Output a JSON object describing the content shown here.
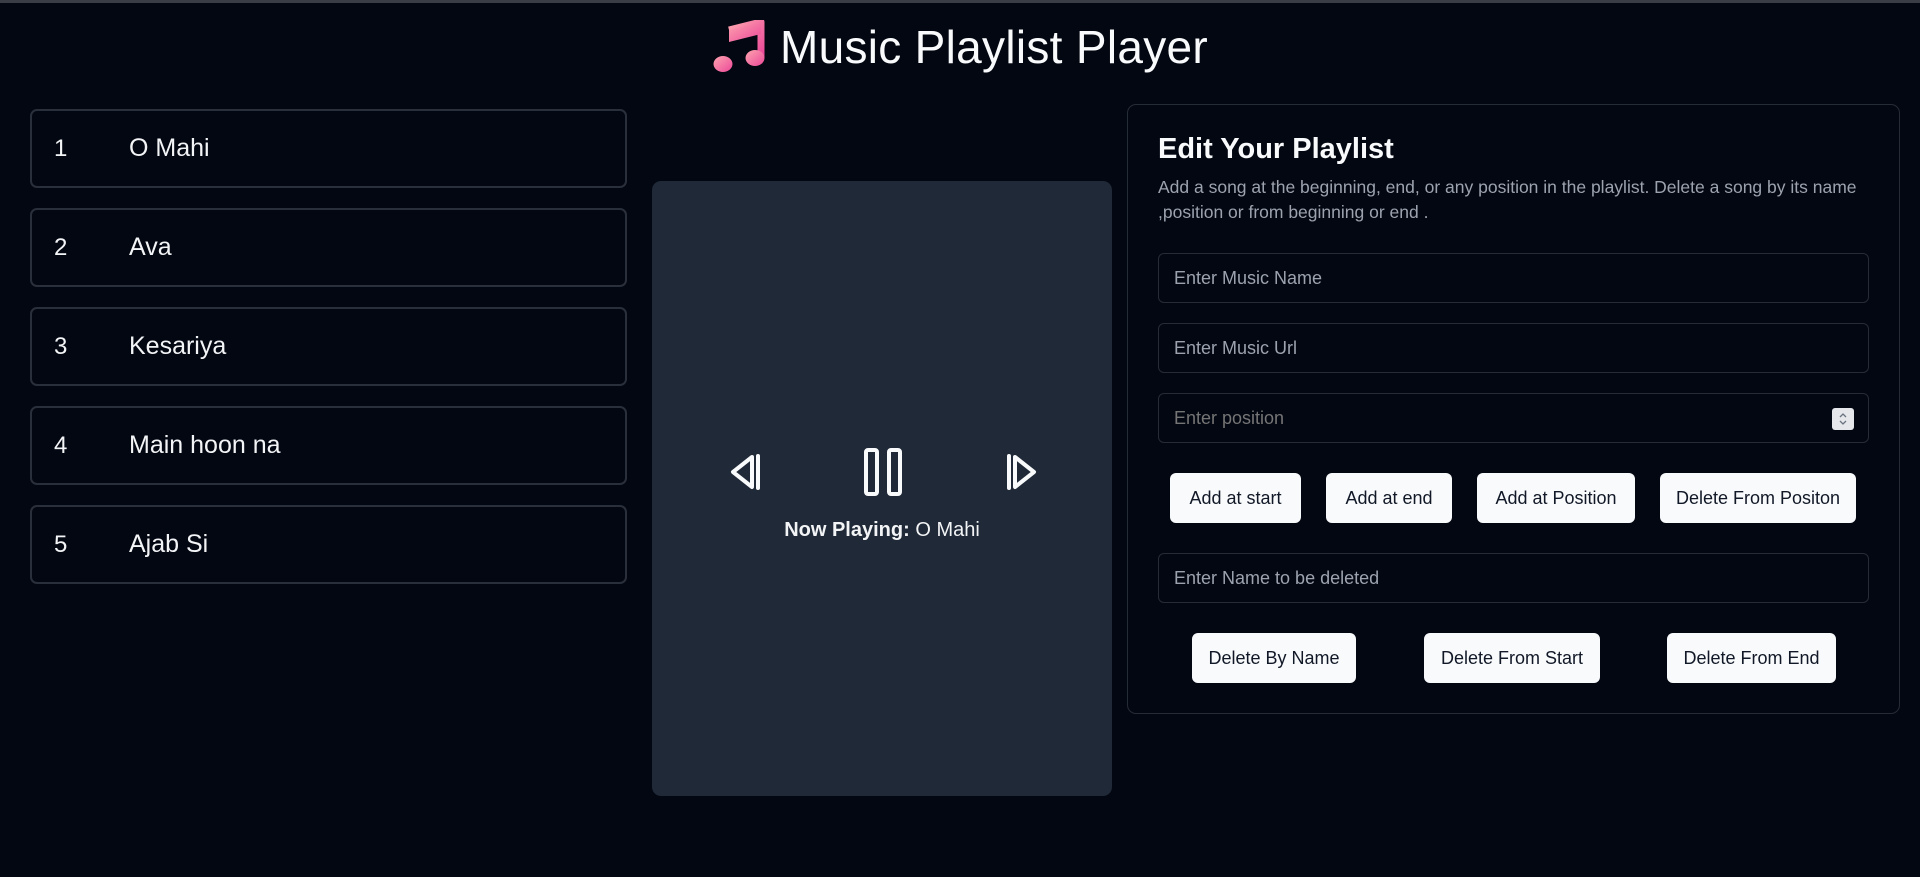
{
  "app": {
    "title": "Music Playlist Player",
    "logo_icon": "music-note-icon",
    "accent_gradient": [
      "#fb7185",
      "#ec4899"
    ]
  },
  "playlist": [
    {
      "num": "1",
      "name": "O Mahi"
    },
    {
      "num": "2",
      "name": "Ava"
    },
    {
      "num": "3",
      "name": "Kesariya"
    },
    {
      "num": "4",
      "name": "Main hoon na"
    },
    {
      "num": "5",
      "name": "Ajab Si"
    }
  ],
  "player": {
    "prev_icon": "skip-previous-icon",
    "pause_icon": "pause-icon",
    "next_icon": "skip-next-icon",
    "now_playing_label": "Now Playing:",
    "now_playing_song": "O Mahi"
  },
  "editor": {
    "title": "Edit Your Playlist",
    "description": "Add a song at the beginning, end, or any position in the playlist. Delete a song by its name ,position or from beginning or end .",
    "name_placeholder": "Enter Music Name",
    "url_placeholder": "Enter Music Url",
    "position_placeholder": "Enter position",
    "delete_name_placeholder": "Enter Name to be deleted",
    "buttons": {
      "add_start": "Add at start",
      "add_end": "Add at end",
      "add_position": "Add at Position",
      "delete_position": "Delete From Positon",
      "delete_name": "Delete By Name",
      "delete_start": "Delete From Start",
      "delete_end": "Delete From End"
    }
  },
  "colors": {
    "background": "#030712",
    "player_panel": "#1f2937",
    "border": "#2a303b",
    "button_bg": "#f9fafb"
  }
}
